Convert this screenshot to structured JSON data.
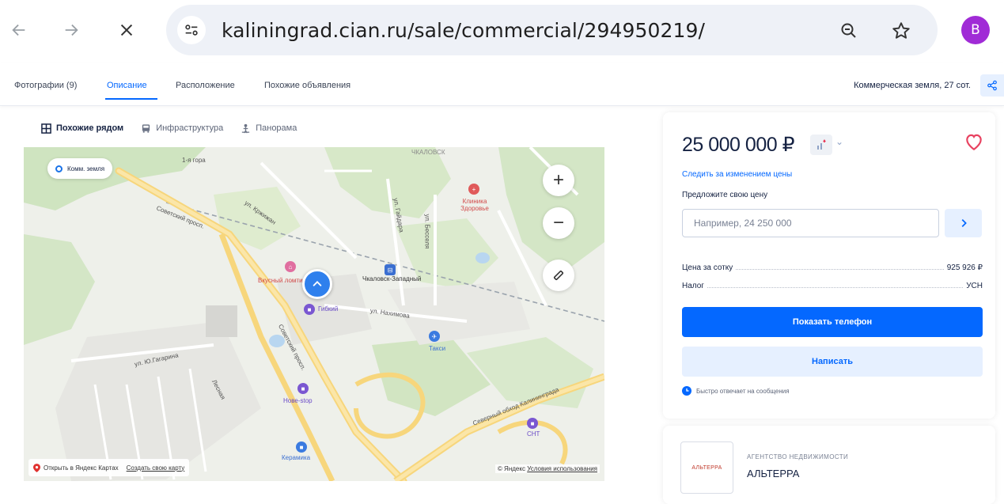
{
  "browser": {
    "url": "kaliningrad.cian.ru/sale/commercial/294950219/",
    "profile_initial": "B",
    "profile_color": "#a02bd6"
  },
  "tabs": {
    "items": [
      "Фотографии (9)",
      "Описание",
      "Расположение",
      "Похожие объявления"
    ],
    "active": "Описание",
    "summary": "Коммерческая земля, 27 сот."
  },
  "map": {
    "modes": [
      "Похожие рядом",
      "Инфраструктура",
      "Панорама"
    ],
    "chip_label": "Комм. земля",
    "places": {
      "clinic": "Клиника Здоровье",
      "station": "Чкаловск-Западный",
      "shop1": "Вкусный ломтик",
      "shop2": "Гибкий",
      "taxi": "Такси",
      "store3": "Нове-stop",
      "store4": "Керамика",
      "store5": "СНТ",
      "district": "ЧКАЛОВСК"
    },
    "roads": {
      "r1": "Советский просп.",
      "r2": "Советский просп.",
      "r3": "ул. Гайдара",
      "r4": "ул. Бесселя",
      "r5": "Северный обход Калининграда",
      "r6": "ул. Нахимова",
      "r7": "ул. Ю.Гагарина",
      "r8": "Лесная",
      "r9": "ул. Кржижан",
      "r10": "1-я гора"
    },
    "footer_open": "Открыть в Яндекс Картах",
    "footer_create": "Создать свою карту",
    "copyright": "© Яндекс",
    "terms": "Условия использования"
  },
  "offer": {
    "price": "25 000 000 ₽",
    "follow_link": "Следить за изменением цены",
    "propose_label": "Предложите свою цену",
    "propose_placeholder": "Например, 24 250 000",
    "price_per_label": "Цена за сотку",
    "price_per_value": "925 926 ₽",
    "tax_label": "Налог",
    "tax_value": "УСН",
    "show_phone": "Показать телефон",
    "write": "Написать",
    "fast_reply": "Быстро отвечает на сообщения"
  },
  "agency": {
    "logo_text": "АЛЬТЕРРА",
    "type": "АГЕНТСТВО НЕДВИЖИМОСТИ",
    "name": "АЛЬТЕРРА"
  },
  "colors": {
    "accent": "#0468ff",
    "accent_light": "#e6f0ff",
    "heart": "#e84260",
    "text": "#152242"
  }
}
